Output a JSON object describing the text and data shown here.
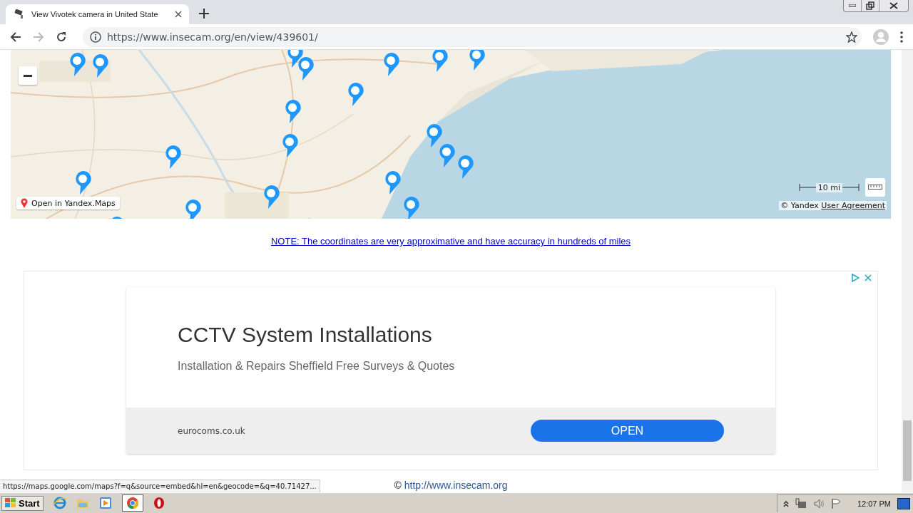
{
  "browser": {
    "tab": {
      "title": "View Vivotek camera in United State",
      "selected": true
    },
    "address": "https://www.insecam.org/en/view/439601/"
  },
  "map": {
    "open_link": "Open in Yandex.Maps",
    "scale": "10 mi",
    "copyright": "© Yandex",
    "agreement": "User Agreement"
  },
  "note": "NOTE: The coordinates are very approximative and have accuracy in hundreds of miles",
  "ad": {
    "title": "CCTV System Installations",
    "subtitle": "Installation & Repairs Sheffield Free Surveys & Quotes",
    "domain": "eurocoms.co.uk",
    "button": "OPEN"
  },
  "footer": {
    "symbol": "©",
    "link": "http://www.insecam.org"
  },
  "status_url": "https://maps.google.com/maps?f=q&source=embed&hl=en&geocode=&q=40.71427...",
  "taskbar": {
    "start": "Start",
    "clock": "12:07 PM"
  }
}
